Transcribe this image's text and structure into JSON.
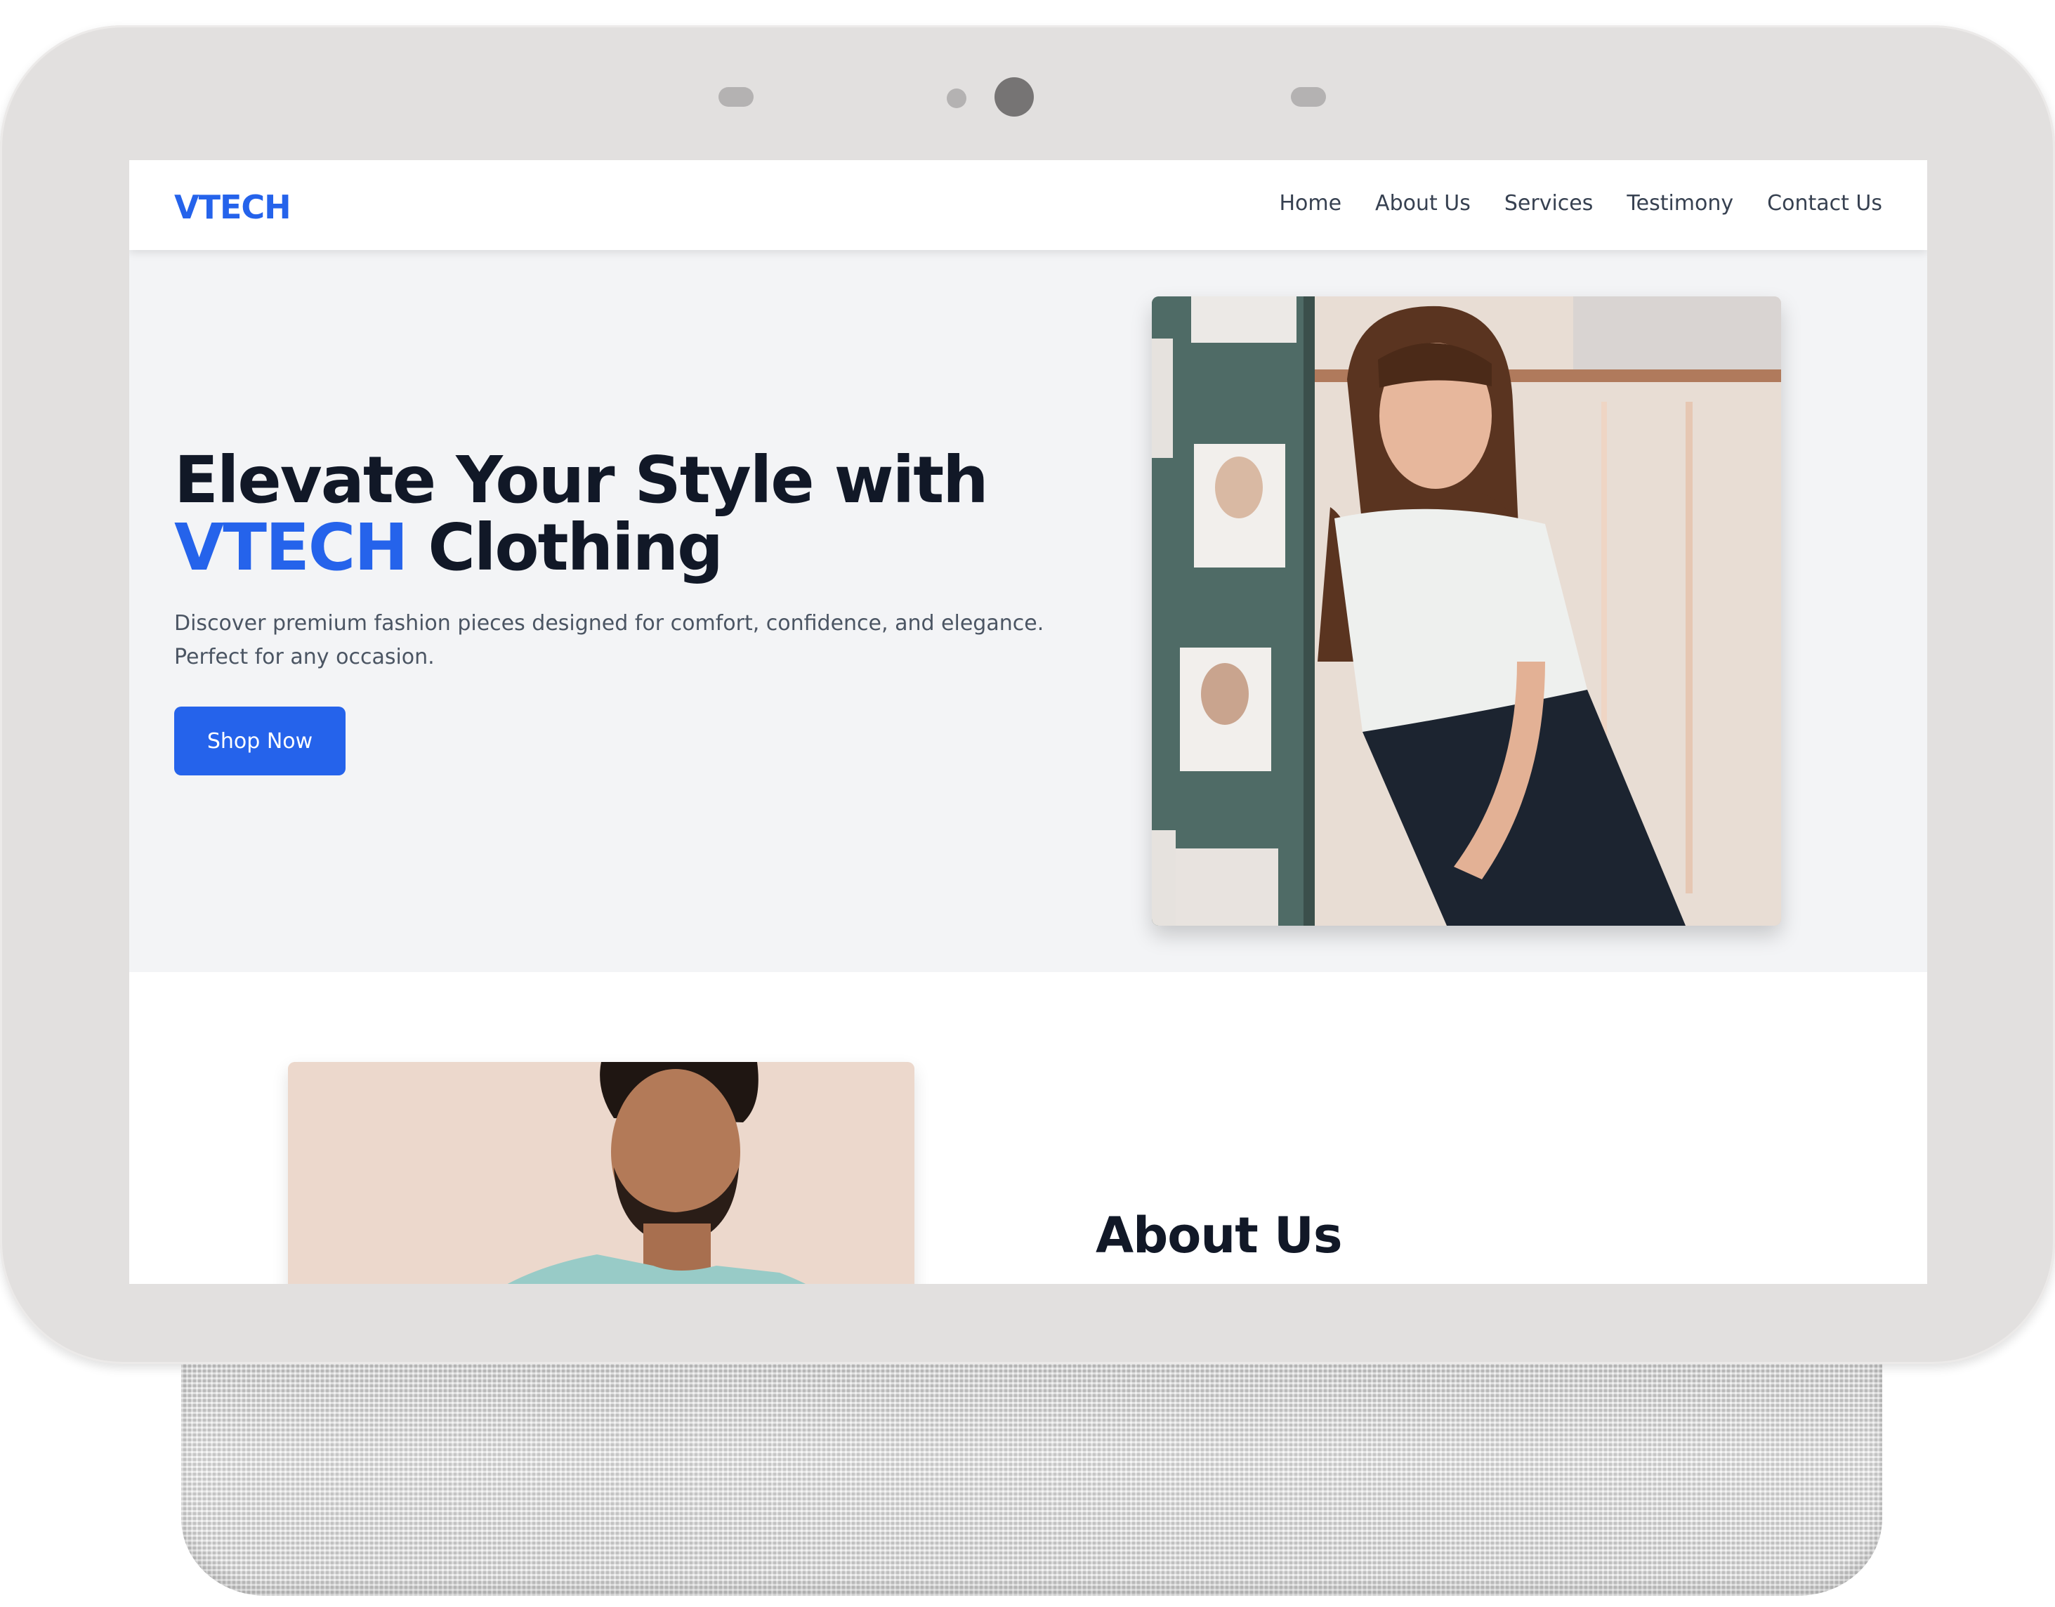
{
  "brand": {
    "name": "VTECH",
    "color": "#2563eb"
  },
  "nav": {
    "items": [
      {
        "label": "Home"
      },
      {
        "label": "About Us"
      },
      {
        "label": "Services"
      },
      {
        "label": "Testimony"
      },
      {
        "label": "Contact Us"
      }
    ]
  },
  "hero": {
    "title_line1": "Elevate Your Style with",
    "title_accent": "VTECH",
    "title_rest": " Clothing",
    "subtitle_line1": "Discover premium fashion pieces designed for comfort, confidence, and elegance.",
    "subtitle_line2": "Perfect for any occasion.",
    "cta_label": "Shop Now",
    "image_icon": "fashion-model-photo"
  },
  "about": {
    "title": "About Us",
    "image_icon": "male-model-photo"
  },
  "colors": {
    "accent": "#2563eb",
    "heading": "#111827",
    "body_text": "#4b5563",
    "hero_bg": "#f3f4f6",
    "device_frame": "#e2e0df"
  }
}
